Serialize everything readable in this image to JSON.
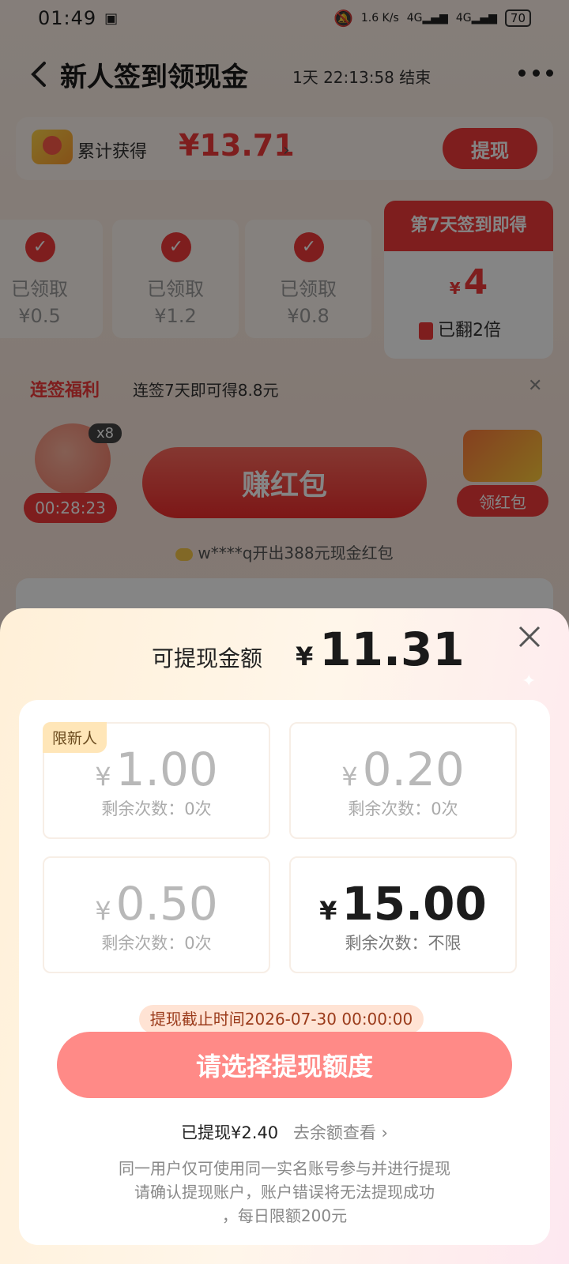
{
  "status_bar": {
    "time": "01:49",
    "net_speed": "1.6 K/s",
    "signal1": "4G",
    "signal2": "4G",
    "battery": "70"
  },
  "header": {
    "title": "新人签到领现金",
    "countdown": "1天 22:13:58 结束"
  },
  "earnings": {
    "label": "累计获得",
    "amount": "¥13.71",
    "withdraw_label": "提现"
  },
  "checkin": {
    "tiles": [
      {
        "status": "已领取",
        "amount": "¥0.5"
      },
      {
        "status": "已领取",
        "amount": "¥1.2"
      },
      {
        "status": "已领取",
        "amount": "¥0.8"
      }
    ],
    "day7": {
      "title": "第7天签到即得",
      "currency": "¥",
      "amount": "4",
      "note": "已翻2倍"
    }
  },
  "streak": {
    "tag": "连签福利",
    "text": "连签7天即可得8.8元"
  },
  "activity": {
    "multiplier": "x8",
    "timer": "00:28:23",
    "earn_label": "赚红包",
    "claim_label": "领红包",
    "ticker": "w****q开出388元现金红包"
  },
  "sheet": {
    "title": "可提现金额",
    "currency": "¥",
    "amount": "11.31",
    "new_tag": "限新人",
    "options": [
      {
        "currency": "¥",
        "amount": "1.00",
        "remaining": "剩余次数：0次"
      },
      {
        "currency": "¥",
        "amount": "0.20",
        "remaining": "剩余次数：0次"
      },
      {
        "currency": "¥",
        "amount": "0.50",
        "remaining": "剩余次数：0次"
      },
      {
        "currency": "¥",
        "amount": "15.00",
        "remaining": "剩余次数：不限"
      }
    ],
    "deadline": "提现截止时间2026-07-30 00:00:00",
    "choose_label": "请选择提现额度",
    "withdrawn": "已提现¥2.40",
    "balance_link": "去余额查看 ›",
    "notes": [
      "同一用户仅可使用同一实名账号参与并进行提现",
      "请确认提现账户，账户错误将无法提现成功",
      "，每日限额200元"
    ]
  }
}
